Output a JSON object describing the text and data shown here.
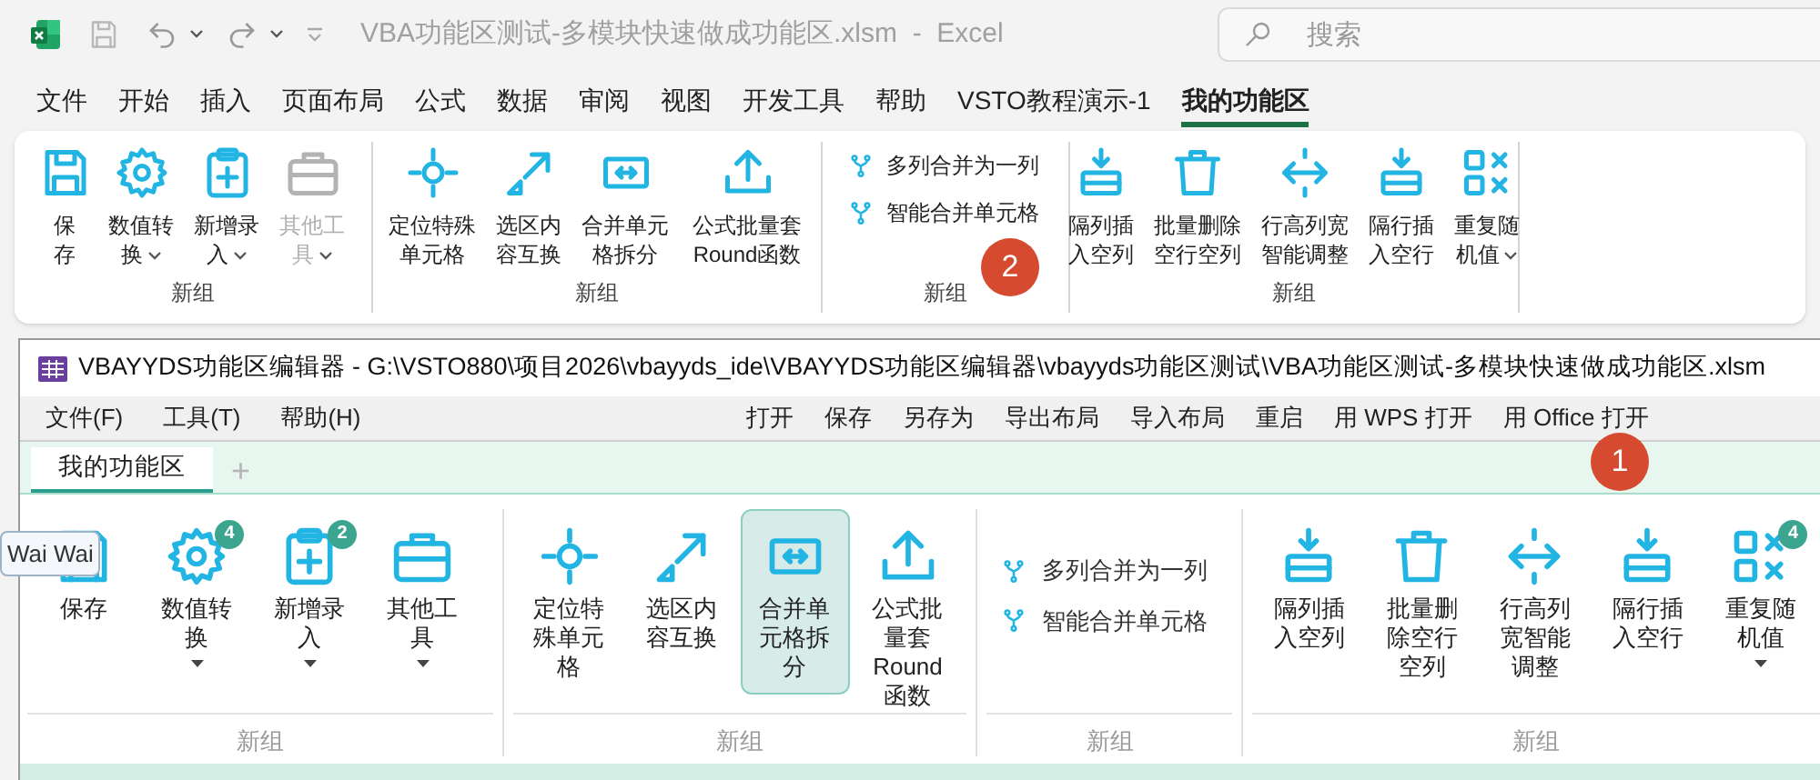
{
  "excel": {
    "title": "VBA功能区测试-多模块快速做成功能区.xlsm  -  Excel",
    "search": {
      "placeholder": "搜索"
    },
    "tabs": [
      {
        "label": "文件",
        "selected": false
      },
      {
        "label": "开始",
        "selected": false
      },
      {
        "label": "插入",
        "selected": false
      },
      {
        "label": "页面布局",
        "selected": false
      },
      {
        "label": "公式",
        "selected": false
      },
      {
        "label": "数据",
        "selected": false
      },
      {
        "label": "审阅",
        "selected": false
      },
      {
        "label": "视图",
        "selected": false
      },
      {
        "label": "开发工具",
        "selected": false
      },
      {
        "label": "帮助",
        "selected": false
      },
      {
        "label": "VSTO教程演示-1",
        "selected": false
      },
      {
        "label": "我的功能区",
        "selected": true
      }
    ],
    "ribbon": {
      "groups": [
        {
          "label": "新组",
          "kind": "large",
          "buttons": [
            {
              "label": "保存",
              "dropdown": false,
              "disabled": false
            },
            {
              "label": "数值转换",
              "dropdown": true,
              "disabled": false
            },
            {
              "label": "新增录入",
              "dropdown": true,
              "disabled": false
            },
            {
              "label": "其他工具",
              "dropdown": true,
              "disabled": true
            }
          ]
        },
        {
          "label": "新组",
          "kind": "large",
          "buttons": [
            {
              "label": "定位特殊单元格",
              "dropdown": false,
              "disabled": false
            },
            {
              "label": "选区内容互换",
              "dropdown": false,
              "disabled": false
            },
            {
              "label": "合并单元格拆分",
              "dropdown": false,
              "disabled": false
            },
            {
              "label": "公式批量套Round函数",
              "dropdown": false,
              "disabled": false
            }
          ]
        },
        {
          "label": "新组",
          "kind": "small",
          "buttons": [
            {
              "label": "多列合并为一列",
              "disabled": false
            },
            {
              "label": "智能合并单元格",
              "disabled": false
            }
          ]
        },
        {
          "label": "新组",
          "kind": "large",
          "buttons": [
            {
              "label": "隔列插入空列",
              "dropdown": false,
              "disabled": false
            },
            {
              "label": "批量删除空行空列",
              "dropdown": false,
              "disabled": false
            },
            {
              "label": "行高列宽智能调整",
              "dropdown": false,
              "disabled": false
            },
            {
              "label": "隔行插入空行",
              "dropdown": false,
              "disabled": false
            },
            {
              "label": "重复随机值",
              "dropdown": true,
              "disabled": false
            }
          ]
        }
      ]
    },
    "callout": "2"
  },
  "editor": {
    "title": "VBAYYDS功能区编辑器 - G:\\VSTO880\\项目2026\\vbayyds_ide\\VBAYYDS功能区编辑器\\vbayyds功能区测试\\VBA功能区测试-多模块快速做成功能区.xlsm",
    "menus": [
      "文件(F)",
      "工具(T)",
      "帮助(H)"
    ],
    "actions": [
      "打开",
      "保存",
      "另存为",
      "导出布局",
      "导入布局",
      "重启",
      "用 WPS 打开",
      "用 Office 打开"
    ],
    "tabs": [
      {
        "label": "我的功能区",
        "selected": true
      }
    ],
    "add_tab": "+",
    "ribbon": {
      "groups": [
        {
          "label": "新组",
          "kind": "large",
          "buttons": [
            {
              "label": "保存",
              "dropdown": false,
              "selected": false
            },
            {
              "label": "数值转换",
              "dropdown": true,
              "selected": false,
              "badge": "4"
            },
            {
              "label": "新增录入",
              "dropdown": true,
              "selected": false,
              "badge": "2"
            },
            {
              "label": "其他工具",
              "dropdown": true,
              "selected": false
            }
          ]
        },
        {
          "label": "新组",
          "kind": "large",
          "buttons": [
            {
              "label": "定位特殊单元格",
              "dropdown": false,
              "selected": false
            },
            {
              "label": "选区内容互换",
              "dropdown": false,
              "selected": false
            },
            {
              "label": "合并单元格拆分",
              "dropdown": false,
              "selected": true
            },
            {
              "label": "公式批量套Round函数",
              "dropdown": false,
              "selected": false
            }
          ]
        },
        {
          "label": "新组",
          "kind": "small",
          "buttons": [
            {
              "label": "多列合并为一列",
              "selected": false
            },
            {
              "label": "智能合并单元格",
              "selected": false
            }
          ]
        },
        {
          "label": "新组",
          "kind": "large",
          "buttons": [
            {
              "label": "隔列插入空列",
              "dropdown": false,
              "selected": false
            },
            {
              "label": "批量删除空行空列",
              "dropdown": false,
              "selected": false
            },
            {
              "label": "行高列宽智能调整",
              "dropdown": false,
              "selected": false
            },
            {
              "label": "隔行插入空行",
              "dropdown": false,
              "selected": false
            },
            {
              "label": "重复随机值",
              "dropdown": true,
              "selected": false,
              "badge": "4"
            }
          ]
        }
      ]
    },
    "tooltip": "Wai Wai",
    "callout": "1"
  }
}
